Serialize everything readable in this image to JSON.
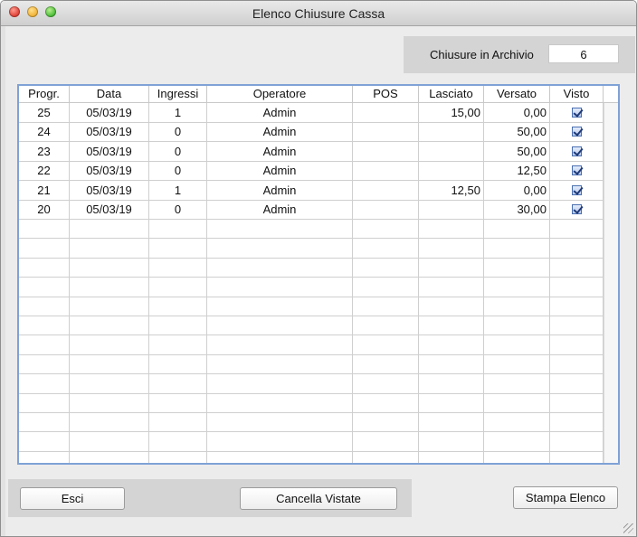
{
  "window": {
    "title": "Elenco Chiusure Cassa"
  },
  "archive": {
    "label": "Chiusure in Archivio",
    "count": "6"
  },
  "table": {
    "columns": [
      "Progr.",
      "Data",
      "Ingressi",
      "Operatore",
      "POS",
      "Lasciato",
      "Versato",
      "Visto"
    ],
    "rows": [
      {
        "progr": "25",
        "data": "05/03/19",
        "ingressi": "1",
        "operatore": "Admin",
        "pos": "",
        "lasciato": "15,00",
        "versato": "0,00",
        "visto": true
      },
      {
        "progr": "24",
        "data": "05/03/19",
        "ingressi": "0",
        "operatore": "Admin",
        "pos": "",
        "lasciato": "",
        "versato": "50,00",
        "visto": true
      },
      {
        "progr": "23",
        "data": "05/03/19",
        "ingressi": "0",
        "operatore": "Admin",
        "pos": "",
        "lasciato": "",
        "versato": "50,00",
        "visto": true
      },
      {
        "progr": "22",
        "data": "05/03/19",
        "ingressi": "0",
        "operatore": "Admin",
        "pos": "",
        "lasciato": "",
        "versato": "12,50",
        "visto": true
      },
      {
        "progr": "21",
        "data": "05/03/19",
        "ingressi": "1",
        "operatore": "Admin",
        "pos": "",
        "lasciato": "12,50",
        "versato": "0,00",
        "visto": true
      },
      {
        "progr": "20",
        "data": "05/03/19",
        "ingressi": "0",
        "operatore": "Admin",
        "pos": "",
        "lasciato": "",
        "versato": "30,00",
        "visto": true
      }
    ]
  },
  "buttons": {
    "esci": "Esci",
    "cancella": "Cancella Vistate",
    "stampa": "Stampa Elenco"
  },
  "icons": {
    "close": "close-traffic-light-icon",
    "minimize": "minimize-traffic-light-icon",
    "zoom": "zoom-traffic-light-icon",
    "checkbox": "checkbox-checked-icon",
    "resize": "resize-grip-icon"
  },
  "colors": {
    "table_border": "#7fa2d6",
    "panel": "#d4d4d4",
    "window_bg": "#ececec"
  }
}
